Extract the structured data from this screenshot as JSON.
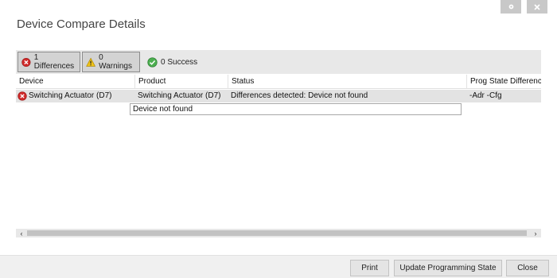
{
  "window": {
    "title": "Device Compare Details",
    "settings_icon": "gear-icon",
    "close_icon": "close-icon"
  },
  "filters": [
    {
      "label": "1 Differences",
      "icon": "error-icon",
      "active": true
    },
    {
      "label": "0 Warnings",
      "icon": "warning-icon",
      "active": true
    },
    {
      "label": "0 Success",
      "icon": "success-icon",
      "active": false
    }
  ],
  "table": {
    "columns": [
      "Device",
      "Product",
      "Status",
      "Prog State Differenc"
    ],
    "rows": [
      {
        "device": "Switching Actuator (D7)",
        "product": "Switching Actuator (D7)",
        "status": "Differences detected: Device not found",
        "prog_state": "-Adr -Cfg",
        "icon": "error-icon",
        "detail": "Device not found"
      }
    ]
  },
  "scrollbar": {
    "left_arrow": "‹",
    "right_arrow": "›"
  },
  "footer": {
    "print_label": "Print",
    "update_label": "Update Programming State",
    "close_label": "Close"
  },
  "colors": {
    "error": "#d02a2a",
    "warning": "#f0c419",
    "success": "#4caf50"
  }
}
